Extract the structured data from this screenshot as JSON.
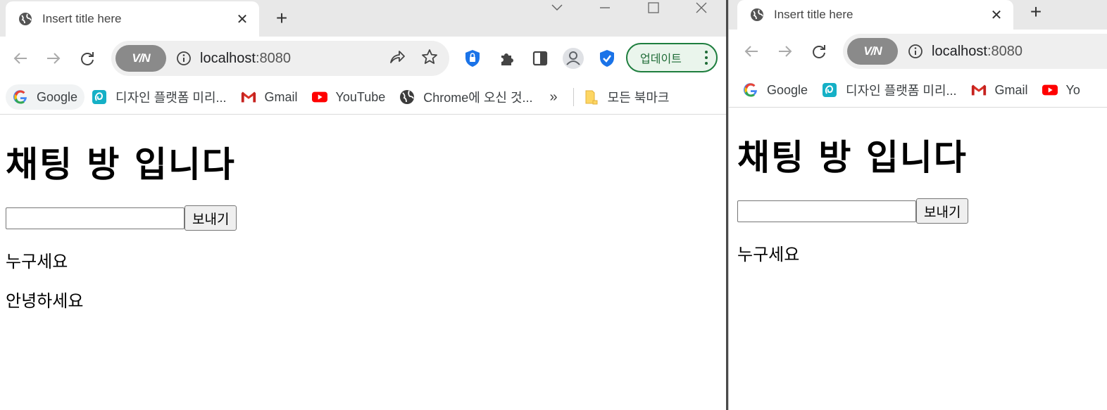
{
  "left_window": {
    "tab": {
      "title": "Insert title here",
      "close": "✕"
    },
    "new_tab": "+",
    "address": {
      "vpn": "V/N",
      "host": "localhost",
      "port": ":8080"
    },
    "update_button": "업데이트",
    "bookmarks": [
      {
        "label": "Google",
        "icon": "google-icon"
      },
      {
        "label": "디자인 플랫폼 미리...",
        "icon": "design-platform-icon"
      },
      {
        "label": "Gmail",
        "icon": "gmail-icon"
      },
      {
        "label": "YouTube",
        "icon": "youtube-icon"
      },
      {
        "label": "Chrome에 오신 것...",
        "icon": "chrome-globe-icon"
      }
    ],
    "more_bookmarks": "»",
    "all_bookmarks": "모든 북마크",
    "page": {
      "heading": "채팅 방 입니다",
      "input_value": "",
      "send_label": "보내기",
      "messages": [
        "누구세요",
        "안녕하세요"
      ]
    }
  },
  "right_window": {
    "tab": {
      "title": "Insert title here",
      "close": "✕"
    },
    "new_tab": "+",
    "address": {
      "vpn": "V/N",
      "host": "localhost",
      "port": ":8080"
    },
    "bookmarks": [
      {
        "label": "Google",
        "icon": "google-icon"
      },
      {
        "label": "디자인 플랫폼 미리...",
        "icon": "design-platform-icon"
      },
      {
        "label": "Gmail",
        "icon": "gmail-icon"
      },
      {
        "label": "Yo",
        "icon": "youtube-icon"
      }
    ],
    "page": {
      "heading": "채팅 방 입니다",
      "input_value": "",
      "send_label": "보내기",
      "messages": [
        "누구세요"
      ]
    }
  },
  "colors": {
    "tabstrip": "#e8e8e8",
    "update_border": "#1e7e3e",
    "update_bg": "#eaf5ec",
    "shield_blue": "#1a73e8"
  }
}
